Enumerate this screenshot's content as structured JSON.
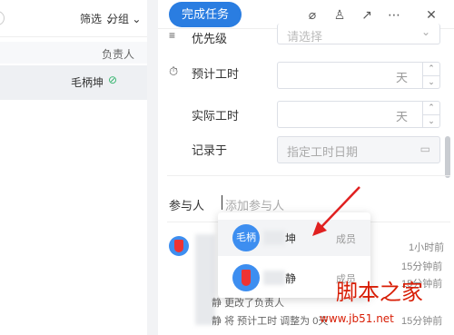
{
  "left": {
    "filter_label": "筛选",
    "group_label": "分组",
    "col_assignee": "负责人",
    "row_assignee": "毛柄坤"
  },
  "toolbar": {
    "complete_label": "完成任务"
  },
  "fields": {
    "priority_label": "优先级",
    "priority_placeholder": "请选择",
    "est_label": "预计工时",
    "est_unit": "天",
    "actual_label": "实际工时",
    "actual_unit": "天",
    "record_label": "记录于",
    "record_placeholder": "指定工时日期"
  },
  "participants": {
    "label": "参与人",
    "placeholder": "添加参与人"
  },
  "dropdown": {
    "items": [
      {
        "avatar_text": "毛柄",
        "name_tail": "坤",
        "role": "成员"
      },
      {
        "avatar_text": "",
        "name_tail": "静",
        "role": "成员"
      }
    ]
  },
  "activity": {
    "times": [
      "1小时前",
      "15分钟前",
      "15分钟前",
      "15分钟前"
    ],
    "lines": [
      "更改了负责人",
      "将 预计工时 调整为 0天"
    ],
    "line_prefix": "静"
  },
  "watermark": {
    "text": "脚本之家",
    "url": "www.jb51.net"
  },
  "colors": {
    "primary": "#2a7de1",
    "avatar": "#3d8ef0",
    "watermark": "#d81e06",
    "arrow": "#e02020"
  }
}
